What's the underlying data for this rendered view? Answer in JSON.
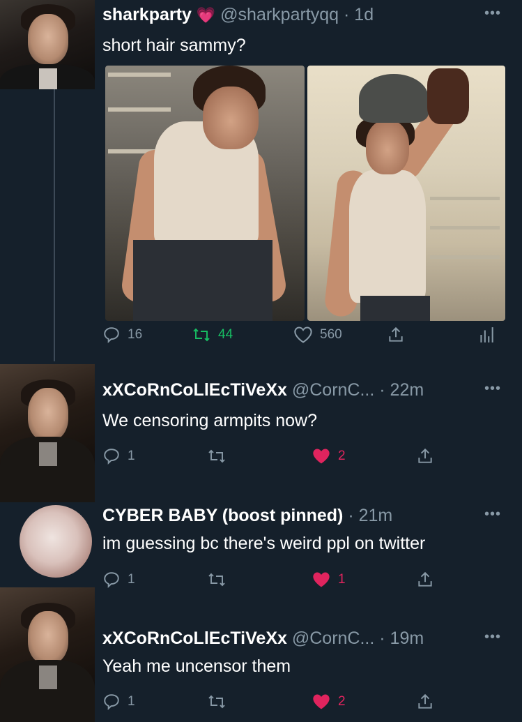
{
  "tweets": [
    {
      "name": "sharkparty",
      "emoji": "💗",
      "handle": "@sharkpartyqq",
      "time": "· 1d",
      "text": "short hair sammy?",
      "media_count": 2,
      "actions": {
        "replies": "16",
        "retweets": "44",
        "likes": "560"
      }
    },
    {
      "name": "xXCoRnCoLlEcTiVeXx",
      "handle": "@CornC...",
      "time": "· 22m",
      "text": "We censoring armpits now?",
      "actions": {
        "replies": "1",
        "retweets": "",
        "likes": "2"
      }
    },
    {
      "name": "CYBER BABY (boost pinned)",
      "handle": "",
      "time": "· 21m",
      "text": "im guessing bc there's weird ppl on twitter",
      "actions": {
        "replies": "1",
        "retweets": "",
        "likes": "1"
      }
    },
    {
      "name": "xXCoRnCoLlEcTiVeXx",
      "handle": "@CornC...",
      "time": "· 19m",
      "text": "Yeah me uncensor them",
      "actions": {
        "replies": "1",
        "retweets": "",
        "likes": "2"
      }
    }
  ],
  "more_label": "•••",
  "colors": {
    "background": "#15202b",
    "secondary_text": "#8899a6",
    "retweet_green": "#17bf63",
    "like_red": "#e0245e"
  },
  "icons": [
    "reply-icon",
    "retweet-icon",
    "like-icon",
    "share-icon",
    "analytics-icon",
    "more-icon"
  ]
}
